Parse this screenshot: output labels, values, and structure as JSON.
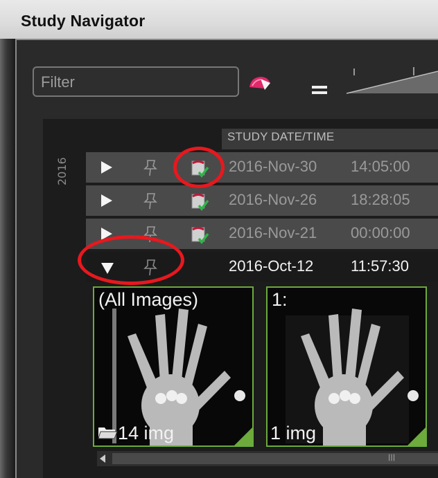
{
  "window": {
    "title": "Study Navigator"
  },
  "filter": {
    "placeholder": "Filter",
    "value": ""
  },
  "toolbar": {
    "clear_icon": "clear-filter-icon",
    "equal_icon": "equal-icon"
  },
  "table": {
    "column_header": "STUDY DATE/TIME",
    "year_group": "2016",
    "rows": [
      {
        "date": "2016-Nov-30",
        "time": "14:05:00",
        "expanded": false,
        "status_icon": "report-verified-icon"
      },
      {
        "date": "2016-Nov-26",
        "time": "18:28:05",
        "expanded": false,
        "status_icon": "report-verified-icon"
      },
      {
        "date": "2016-Nov-21",
        "time": "00:00:00",
        "expanded": false,
        "status_icon": "report-verified-icon"
      },
      {
        "date": "2016-Oct-12",
        "time": "11:57:30",
        "expanded": true,
        "status_icon": ""
      }
    ]
  },
  "thumbnails": [
    {
      "top_label": "(All Images)",
      "bottom_label": "14 img",
      "icon": "folder-icon"
    },
    {
      "top_label": "1:",
      "bottom_label": "1 img",
      "icon": ""
    }
  ],
  "colors": {
    "accent_green": "#6cab3c",
    "annotation_red": "#e8181e"
  }
}
